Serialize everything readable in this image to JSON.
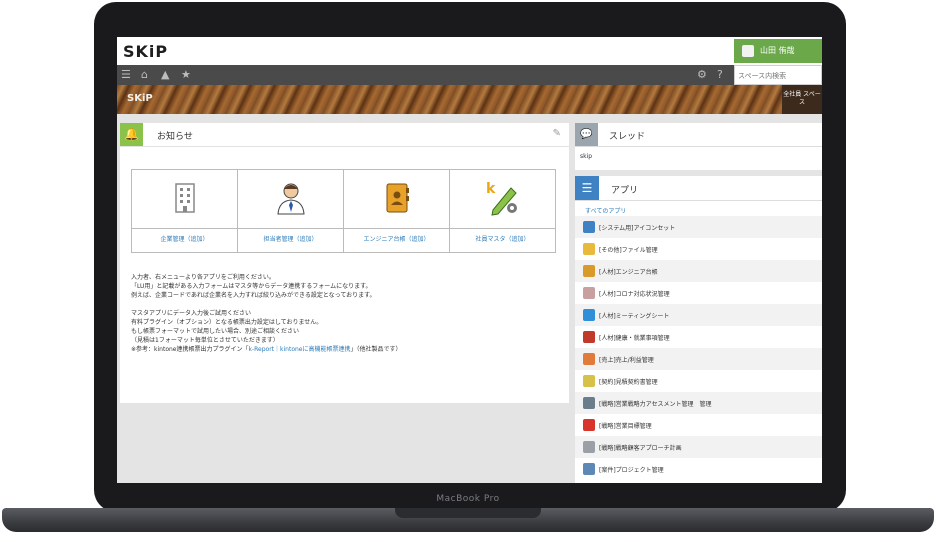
{
  "app": {
    "logo": "SKiP",
    "user_name": "山田 侑哉",
    "search_placeholder": "スペース内検索",
    "banner_title": "SKiP",
    "banner_side": "全社員 スペース"
  },
  "notice": {
    "title": "お知らせ",
    "links": [
      "企業管理（追加）",
      "担当者管理（追加）",
      "エンジニア台帳（追加）",
      "社員マスタ（追加）"
    ],
    "lines": [
      "入力者、右メニューより各アプリをご利用ください。",
      "「LU用」と記載がある入力フォームはマスタ等からデータ連携するフォームになります。",
      "例えば、企業コードであれば企業名を入力すれば絞り込みができる設定となっております。",
      "",
      "マスタアプリにデータ入力後ご試用ください",
      "有料プラグイン（オプション）となる帳票出力設定はしておりません。",
      "もし帳票フォーマットで試用したい場合、別途ご相談ください",
      "（見積は1フォーマット毎単位とさせていただきます）"
    ],
    "ref_prefix": "※参考：kintone連携帳票出力プラグイン「",
    "ref_link": "k-Report｜kintoneに高機能帳票連携",
    "ref_suffix": "」（他社製品です）"
  },
  "thread": {
    "title": "スレッド",
    "item": "skip"
  },
  "apps": {
    "title": "アプリ",
    "all_link": "すべてのアプリ",
    "items": [
      {
        "name": "[システム用]アイコンセット",
        "color": "#3f82c4"
      },
      {
        "name": "[その他]ファイル管理",
        "color": "#e8b93a"
      },
      {
        "name": "[人材]エンジニア台帳",
        "color": "#d99a2b"
      },
      {
        "name": "[人材]コロナ対応状況管理",
        "color": "#c9a0a0"
      },
      {
        "name": "[人材]ミーティングシート",
        "color": "#2f8fd8"
      },
      {
        "name": "[人材]健康・就業事項管理",
        "color": "#c0392b"
      },
      {
        "name": "[売上]売上/利益管理",
        "color": "#e07b3a"
      },
      {
        "name": "[契約]見積契約書管理",
        "color": "#d6c24a"
      },
      {
        "name": "[戦略]営業戦略力アセスメント管理　管理",
        "color": "#6a7d8c"
      },
      {
        "name": "[戦略]営業目標管理",
        "color": "#d9342b"
      },
      {
        "name": "[戦略]戦略顧客アプローチ計画",
        "color": "#9aa0a6"
      },
      {
        "name": "[案件]プロジェクト管理",
        "color": "#5d87b5"
      }
    ]
  },
  "device": {
    "label": "MacBook Pro"
  }
}
